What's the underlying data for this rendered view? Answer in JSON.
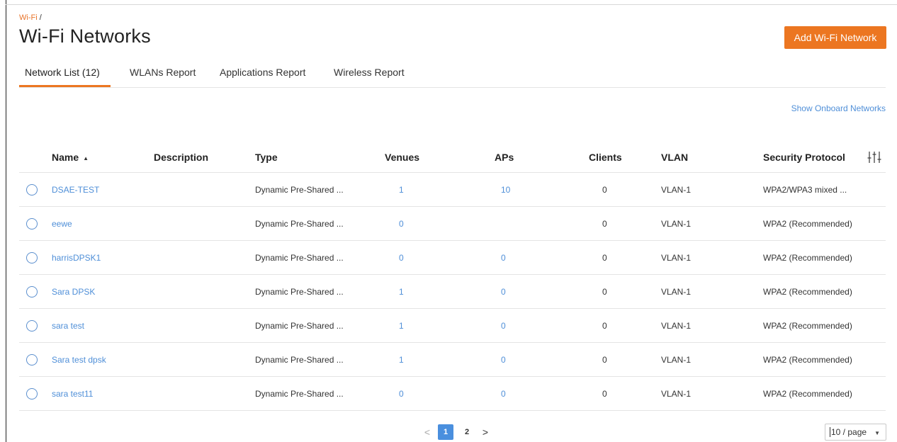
{
  "breadcrumb": {
    "link": "Wi-Fi",
    "separator": " /"
  },
  "page_title": "Wi-Fi Networks",
  "add_button": "Add Wi-Fi Network",
  "tabs": [
    {
      "label": "Network List (12)",
      "active": true
    },
    {
      "label": "WLANs Report"
    },
    {
      "label": "Applications Report"
    },
    {
      "label": "Wireless Report"
    }
  ],
  "onboard_link": "Show Onboard Networks",
  "columns": {
    "name": "Name",
    "description": "Description",
    "type": "Type",
    "venues": "Venues",
    "aps": "APs",
    "clients": "Clients",
    "vlan": "VLAN",
    "security": "Security Protocol"
  },
  "sort_indicator": "▲",
  "rows": [
    {
      "name": "DSAE-TEST",
      "description": "",
      "type": "Dynamic Pre-Shared ...",
      "venues": "1",
      "aps": "10",
      "clients": "0",
      "vlan": "VLAN-1",
      "security": "WPA2/WPA3 mixed ..."
    },
    {
      "name": "eewe",
      "description": "",
      "type": "Dynamic Pre-Shared ...",
      "venues": "0",
      "aps": "",
      "clients": "0",
      "vlan": "VLAN-1",
      "security": "WPA2 (Recommended)"
    },
    {
      "name": "harrisDPSK1",
      "description": "",
      "type": "Dynamic Pre-Shared ...",
      "venues": "0",
      "aps": "0",
      "clients": "0",
      "vlan": "VLAN-1",
      "security": "WPA2 (Recommended)"
    },
    {
      "name": "Sara DPSK",
      "description": "",
      "type": "Dynamic Pre-Shared ...",
      "venues": "1",
      "aps": "0",
      "clients": "0",
      "vlan": "VLAN-1",
      "security": "WPA2 (Recommended)"
    },
    {
      "name": "sara test",
      "description": "",
      "type": "Dynamic Pre-Shared ...",
      "venues": "1",
      "aps": "0",
      "clients": "0",
      "vlan": "VLAN-1",
      "security": "WPA2 (Recommended)"
    },
    {
      "name": "Sara test dpsk",
      "description": "",
      "type": "Dynamic Pre-Shared ...",
      "venues": "1",
      "aps": "0",
      "clients": "0",
      "vlan": "VLAN-1",
      "security": "WPA2 (Recommended)"
    },
    {
      "name": "sara test11",
      "description": "",
      "type": "Dynamic Pre-Shared ...",
      "venues": "0",
      "aps": "0",
      "clients": "0",
      "vlan": "VLAN-1",
      "security": "WPA2 (Recommended)"
    }
  ],
  "pagination": {
    "prev": "<",
    "pages": [
      "1",
      "2"
    ],
    "current": "1",
    "next": ">",
    "page_size": "10 / page"
  },
  "colors": {
    "accent": "#ec7621",
    "link": "#4f8fd8",
    "current_page": "#4a8fde"
  }
}
